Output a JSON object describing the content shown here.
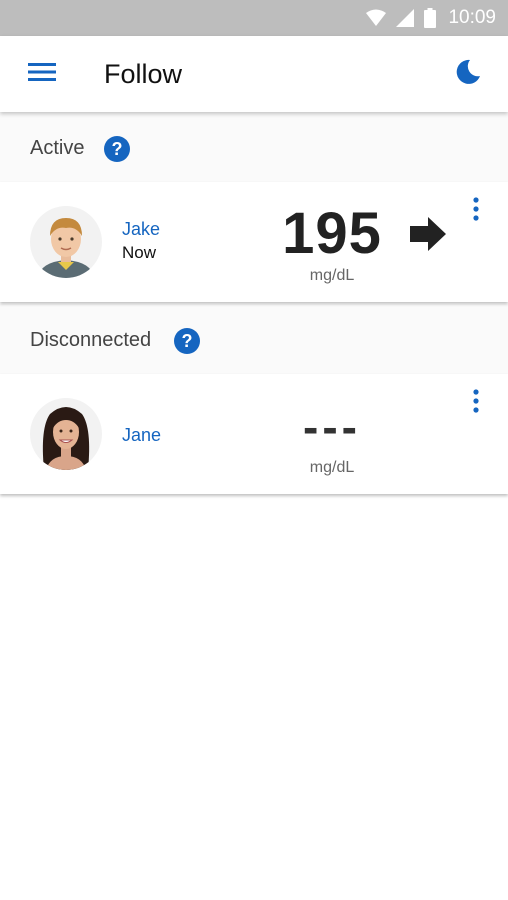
{
  "status_bar": {
    "time": "10:09",
    "icons": [
      "wifi-icon",
      "cell-signal-icon",
      "battery-icon"
    ]
  },
  "app_bar": {
    "title": "Follow",
    "menu_icon": "hamburger-menu-icon",
    "action_icon": "moon-icon"
  },
  "sections": {
    "active": {
      "label": "Active",
      "help_icon": "help-circle-icon"
    },
    "disconnected": {
      "label": "Disconnected",
      "help_icon": "help-circle-icon"
    }
  },
  "followers": {
    "active": [
      {
        "name": "Jake",
        "time": "Now",
        "glucose_value": "195",
        "unit": "mg/dL",
        "trend_icon": "arrow-right-icon"
      }
    ],
    "disconnected": [
      {
        "name": "Jane",
        "glucose_value": "---",
        "unit": "mg/dL"
      }
    ]
  },
  "colors": {
    "accent": "#1565c0",
    "status_bar": "#bdbdbd",
    "section_bg": "#fafafa",
    "glucose_text": "#222222"
  }
}
